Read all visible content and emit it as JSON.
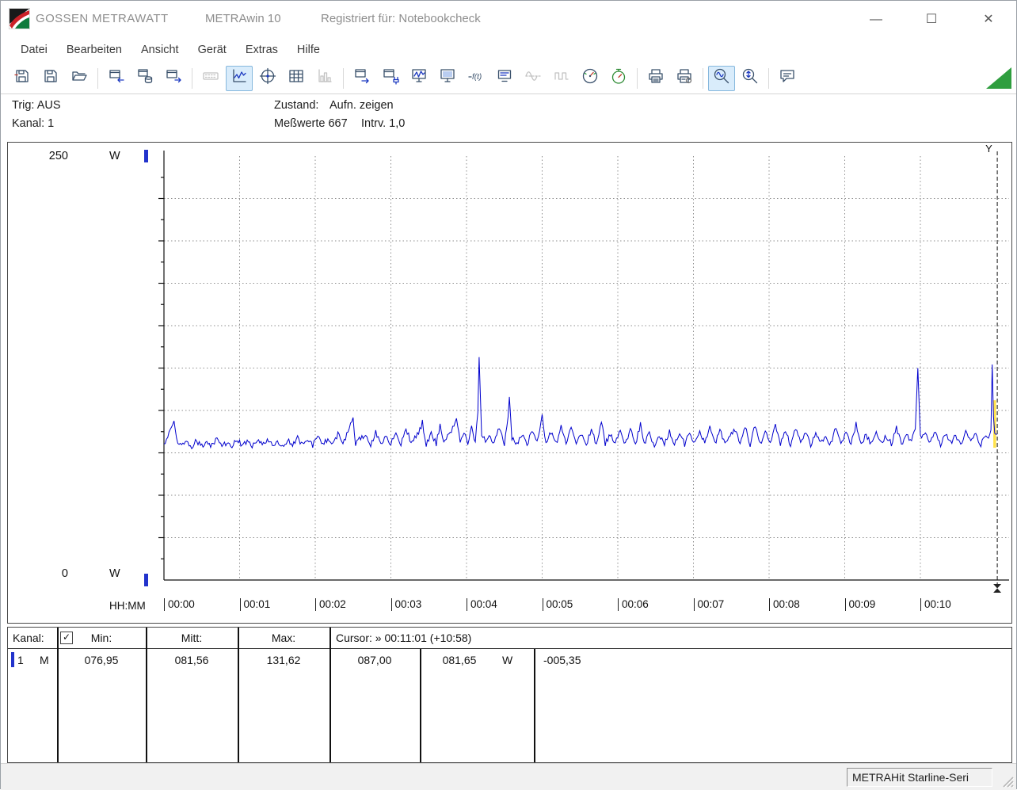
{
  "window": {
    "title_brand": "GOSSEN METRAWATT",
    "title_app": "METRAwin 10",
    "title_registered": "Registriert für: Notebookcheck",
    "controls": {
      "minimize": "—",
      "maximize": "☐",
      "close": "✕"
    }
  },
  "menu": {
    "items": [
      "Datei",
      "Bearbeiten",
      "Ansicht",
      "Gerät",
      "Extras",
      "Hilfe"
    ]
  },
  "toolbar": {
    "buttons": [
      {
        "icon": "open-file"
      },
      {
        "icon": "save-file"
      },
      {
        "icon": "folder-open"
      },
      {
        "sep": true
      },
      {
        "icon": "window-import"
      },
      {
        "icon": "db-export"
      },
      {
        "icon": "window-export"
      },
      {
        "sep": true
      },
      {
        "icon": "keyboard",
        "disabled": true
      },
      {
        "icon": "line-chart",
        "pressed": true
      },
      {
        "icon": "crosshair-chart"
      },
      {
        "icon": "table-view"
      },
      {
        "icon": "histogram",
        "disabled": true
      },
      {
        "sep": true
      },
      {
        "icon": "device-export"
      },
      {
        "icon": "device-connect"
      },
      {
        "icon": "live-monitor"
      },
      {
        "icon": "monitor"
      },
      {
        "icon": "formula"
      },
      {
        "icon": "display"
      },
      {
        "icon": "waveform-sine",
        "disabled": true
      },
      {
        "icon": "waveform-square",
        "disabled": true
      },
      {
        "icon": "meter"
      },
      {
        "icon": "stopwatch"
      },
      {
        "sep": true
      },
      {
        "icon": "print"
      },
      {
        "icon": "print-setup"
      },
      {
        "sep": true
      },
      {
        "icon": "zoom-time",
        "pressed": true
      },
      {
        "icon": "zoom-amplitude"
      },
      {
        "sep": true
      },
      {
        "icon": "annotation"
      }
    ]
  },
  "status_panel": {
    "trig_label": "Trig: AUS",
    "kanal_label": "Kanal: 1",
    "zustand_label": "Zustand:",
    "zustand_value": "Aufn. zeigen",
    "messwerte": "Meßwerte 667",
    "intervall": "Intrv. 1,0"
  },
  "chart_data": {
    "type": "line",
    "title": "",
    "ylabel_unit": "W",
    "y_max_label": "250",
    "y_min_label": "0",
    "ylim": [
      0,
      250
    ],
    "grid_step_w": 25,
    "x_axis_label": "HH:MM",
    "x_tick_labels": [
      "00:00",
      "00:01",
      "00:02",
      "00:03",
      "00:04",
      "00:05",
      "00:06",
      "00:07",
      "00:08",
      "00:09",
      "00:10"
    ],
    "seconds_per_division": 60,
    "cursor": {
      "t": 661,
      "handle_top": "Y",
      "time_label": "00:11:01 (+10:58)"
    },
    "stats": {
      "min": 76.95,
      "mean": 81.56,
      "max": 131.62
    },
    "noise": {
      "amp": 1.7,
      "seed": 20417
    },
    "highlight": {
      "from_w": 78,
      "to_w": 106,
      "color": "#ffe24a"
    },
    "anchors": [
      [
        0,
        80
      ],
      [
        3,
        84
      ],
      [
        6,
        90
      ],
      [
        8,
        95
      ],
      [
        10,
        82
      ],
      [
        14,
        79.5
      ],
      [
        18,
        81
      ],
      [
        22,
        79
      ],
      [
        26,
        82
      ],
      [
        30,
        79.5
      ],
      [
        34,
        81.5
      ],
      [
        38,
        79
      ],
      [
        42,
        83
      ],
      [
        46,
        79.5
      ],
      [
        50,
        81
      ],
      [
        54,
        79
      ],
      [
        58,
        82.5
      ],
      [
        62,
        79.5
      ],
      [
        66,
        81
      ],
      [
        70,
        79.5
      ],
      [
        74,
        82
      ],
      [
        78,
        79.5
      ],
      [
        82,
        83.5
      ],
      [
        86,
        79.5
      ],
      [
        90,
        81
      ],
      [
        94,
        79.5
      ],
      [
        98,
        82
      ],
      [
        102,
        80
      ],
      [
        106,
        84
      ],
      [
        110,
        79.5
      ],
      [
        114,
        81.5
      ],
      [
        118,
        79.5
      ],
      [
        122,
        85
      ],
      [
        126,
        80
      ],
      [
        130,
        83
      ],
      [
        134,
        79.5
      ],
      [
        138,
        86
      ],
      [
        142,
        80
      ],
      [
        146,
        88
      ],
      [
        150,
        95
      ],
      [
        152,
        80
      ],
      [
        156,
        84
      ],
      [
        160,
        86
      ],
      [
        164,
        80
      ],
      [
        168,
        87
      ],
      [
        172,
        80
      ],
      [
        176,
        84.5
      ],
      [
        180,
        80
      ],
      [
        184,
        88
      ],
      [
        188,
        80
      ],
      [
        192,
        90
      ],
      [
        196,
        80.5
      ],
      [
        200,
        85
      ],
      [
        204,
        90
      ],
      [
        205,
        93
      ],
      [
        208,
        80
      ],
      [
        212,
        87
      ],
      [
        216,
        80
      ],
      [
        219,
        92
      ],
      [
        222,
        80.5
      ],
      [
        226,
        86
      ],
      [
        229,
        90
      ],
      [
        232,
        95
      ],
      [
        235,
        80.5
      ],
      [
        238,
        88
      ],
      [
        241,
        80
      ],
      [
        244,
        90
      ],
      [
        247,
        82
      ],
      [
        249,
        100
      ],
      [
        250,
        131.6
      ],
      [
        252,
        86
      ],
      [
        255,
        82
      ],
      [
        258,
        86
      ],
      [
        262,
        80.5
      ],
      [
        266,
        90
      ],
      [
        270,
        80
      ],
      [
        273,
        96
      ],
      [
        274,
        108
      ],
      [
        276,
        84
      ],
      [
        280,
        80.5
      ],
      [
        284,
        86
      ],
      [
        288,
        80
      ],
      [
        292,
        88
      ],
      [
        296,
        80.5
      ],
      [
        300,
        96
      ],
      [
        303,
        80.5
      ],
      [
        307,
        87
      ],
      [
        311,
        80
      ],
      [
        315,
        90
      ],
      [
        319,
        80.5
      ],
      [
        323,
        91
      ],
      [
        327,
        80
      ],
      [
        331,
        86.5
      ],
      [
        335,
        80
      ],
      [
        339,
        89
      ],
      [
        343,
        80.5
      ],
      [
        347,
        93
      ],
      [
        350,
        80.5
      ],
      [
        354,
        86
      ],
      [
        358,
        80
      ],
      [
        362,
        88
      ],
      [
        366,
        80.5
      ],
      [
        370,
        89
      ],
      [
        374,
        80
      ],
      [
        378,
        92
      ],
      [
        381,
        80.5
      ],
      [
        385,
        86
      ],
      [
        389,
        80
      ],
      [
        393,
        85
      ],
      [
        397,
        81
      ],
      [
        401,
        88
      ],
      [
        405,
        80.5
      ],
      [
        409,
        86
      ],
      [
        413,
        80
      ],
      [
        417,
        87
      ],
      [
        421,
        80.5
      ],
      [
        425,
        89
      ],
      [
        429,
        80
      ],
      [
        433,
        90
      ],
      [
        437,
        80.5
      ],
      [
        441,
        88
      ],
      [
        445,
        80
      ],
      [
        449,
        86
      ],
      [
        453,
        88
      ],
      [
        457,
        80.5
      ],
      [
        461,
        90
      ],
      [
        465,
        80
      ],
      [
        469,
        91
      ],
      [
        473,
        80.5
      ],
      [
        477,
        87
      ],
      [
        481,
        80
      ],
      [
        485,
        92
      ],
      [
        489,
        80.5
      ],
      [
        493,
        87
      ],
      [
        497,
        80
      ],
      [
        501,
        90
      ],
      [
        505,
        80.5
      ],
      [
        509,
        88
      ],
      [
        513,
        80
      ],
      [
        517,
        86
      ],
      [
        521,
        80.5
      ],
      [
        525,
        85
      ],
      [
        529,
        80
      ],
      [
        533,
        91
      ],
      [
        537,
        80.5
      ],
      [
        541,
        87
      ],
      [
        545,
        80
      ],
      [
        549,
        92
      ],
      [
        553,
        80.5
      ],
      [
        557,
        86
      ],
      [
        561,
        80
      ],
      [
        565,
        88
      ],
      [
        569,
        80.5
      ],
      [
        573,
        85
      ],
      [
        577,
        80
      ],
      [
        581,
        90
      ],
      [
        585,
        80.5
      ],
      [
        589,
        85
      ],
      [
        593,
        81
      ],
      [
        596,
        90
      ],
      [
        598,
        125
      ],
      [
        600,
        84
      ],
      [
        604,
        86
      ],
      [
        608,
        80.5
      ],
      [
        612,
        88
      ],
      [
        616,
        80
      ],
      [
        620,
        87
      ],
      [
        624,
        80.5
      ],
      [
        628,
        85
      ],
      [
        632,
        80
      ],
      [
        636,
        87
      ],
      [
        640,
        80.5
      ],
      [
        644,
        86
      ],
      [
        648,
        80
      ],
      [
        651,
        84
      ],
      [
        654,
        83
      ],
      [
        656,
        90
      ],
      [
        657,
        127
      ],
      [
        658,
        95
      ],
      [
        659,
        88
      ],
      [
        661,
        85
      ]
    ]
  },
  "table": {
    "header": {
      "kanal": "Kanal:",
      "check_glyph": "✓",
      "min": "Min:",
      "mitt": "Mitt:",
      "max": "Max:",
      "cursor": "Cursor: » 00:11:01 (+10:58)"
    },
    "row": {
      "channel": "1",
      "mode": "M",
      "min": "076,95",
      "mitt": "081,56",
      "max": "131,62",
      "cursor_a": "087,00",
      "cursor_b": "081,65",
      "unit": "W",
      "delta": "-005,35"
    }
  },
  "statusbar": {
    "device": "METRAHit Starline-Seri"
  },
  "colors": {
    "trace": "#0000cd",
    "accent_blue": "#2233cc",
    "pressed_bg": "#d9ecfb",
    "green": "#2f9e3f"
  }
}
